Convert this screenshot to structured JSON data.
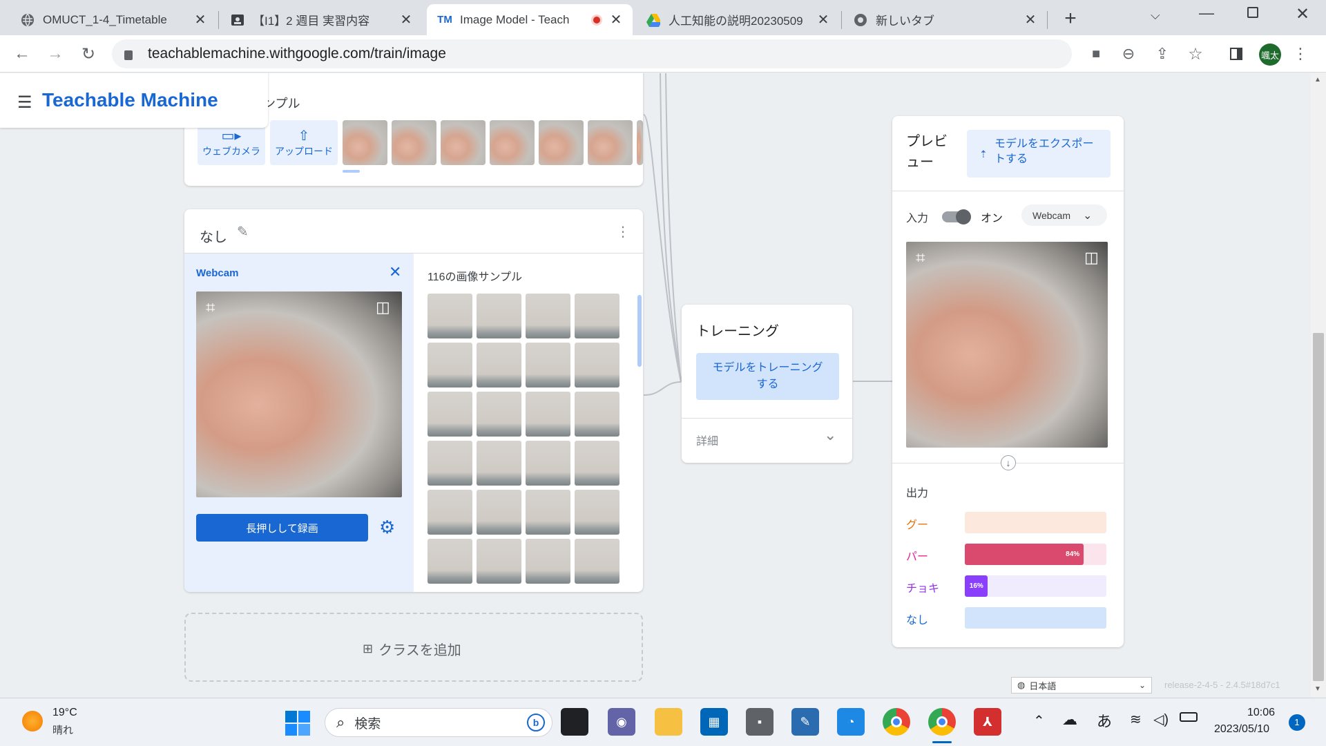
{
  "browser": {
    "tabs": [
      {
        "title": "OMUCT_1-4_Timetable"
      },
      {
        "title": "【I1】2 週目 実習内容"
      },
      {
        "title": "Image Model - Teach"
      },
      {
        "title": "人工知能の説明20230509"
      },
      {
        "title": "新しいタブ"
      }
    ],
    "new_tab": "+",
    "url": "teachablemachine.withgoogle.com/train/image",
    "profile_initials": "颯太"
  },
  "app": {
    "title": "Teachable Machine",
    "top_class": {
      "samples_label_partial": "ンプル",
      "webcam_btn": "ウェブカメラ",
      "upload_btn": "アップロード"
    },
    "class_nashi": {
      "name": "なし",
      "webcam_title": "Webcam",
      "samples_count": "116の画像サンプル",
      "record_btn": "長押しして録画"
    },
    "add_class": "クラスを追加",
    "training": {
      "title": "トレーニング",
      "train_btn": "モデルをトレーニングする",
      "details": "詳細"
    },
    "preview": {
      "title": "プレビュー",
      "export_btn": "モデルをエクスポートする",
      "input_label": "入力",
      "input_state": "オン",
      "input_source": "Webcam",
      "output_label": "出力",
      "outputs": [
        {
          "label": "グー",
          "value": 0,
          "color": "#e8710a",
          "track": "#fde8dd",
          "fill": "#e8710a"
        },
        {
          "label": "パー",
          "value": 84,
          "display": "84%",
          "color": "#e52592",
          "track": "#fce4ec",
          "fill": "#d94a6e"
        },
        {
          "label": "チョキ",
          "value": 16,
          "display": "16%",
          "color": "#9334e6",
          "track": "#f1ecfd",
          "fill": "#8a3ffc"
        },
        {
          "label": "なし",
          "value": 0,
          "color": "#1967d2",
          "track": "#d2e3fc",
          "fill": "#1967d2"
        }
      ]
    },
    "language": "日本語",
    "release": "release-2-4-5 - 2.4.5#18d7c1"
  },
  "taskbar": {
    "weather_temp": "19°C",
    "weather_text": "晴れ",
    "search_placeholder": "検索",
    "ime": "あ",
    "time": "10:06",
    "date": "2023/05/10",
    "notification_count": "1"
  }
}
